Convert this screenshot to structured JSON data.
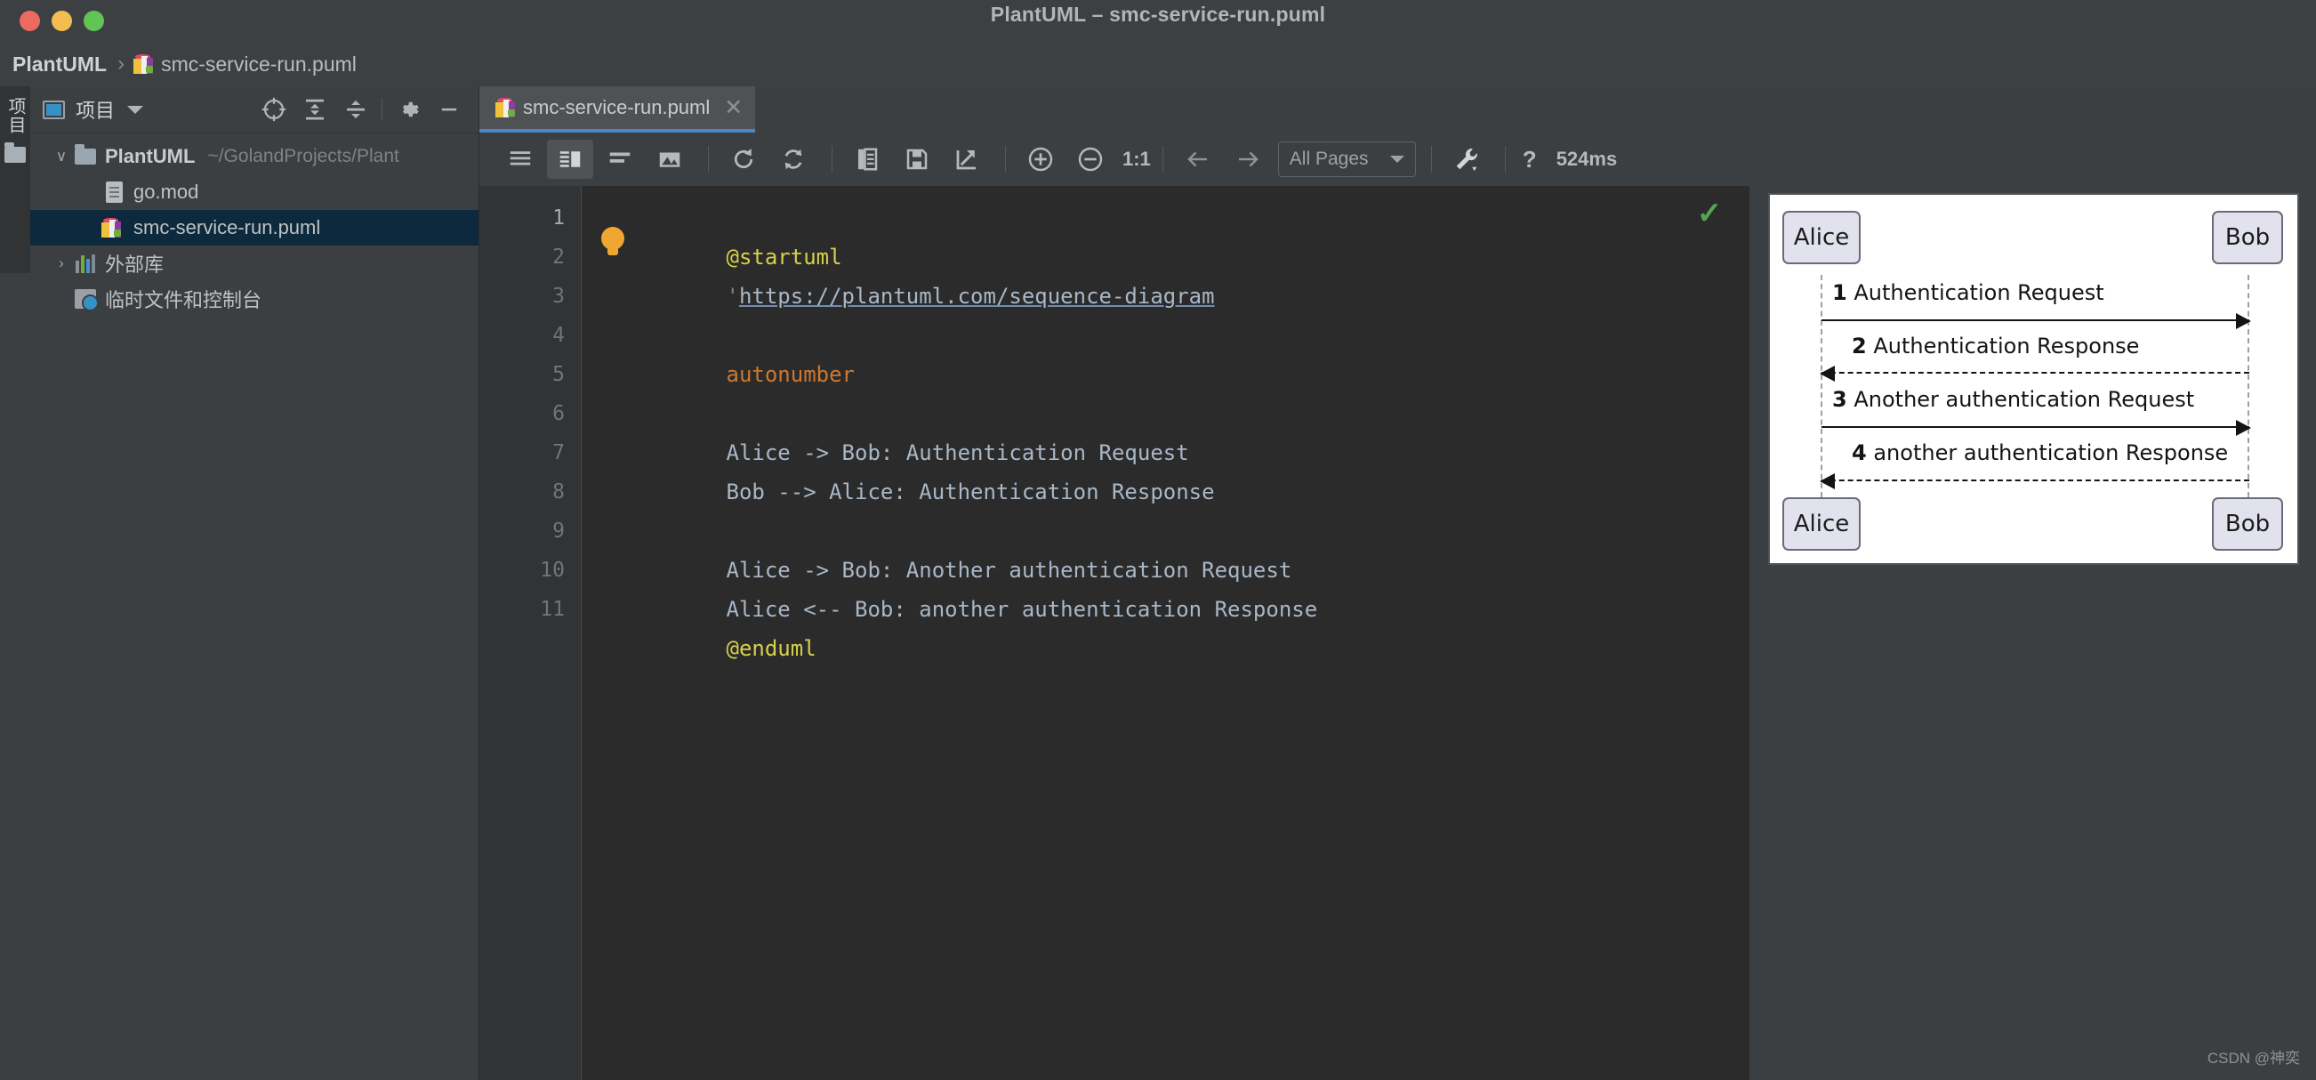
{
  "window": {
    "title": "PlantUML – smc-service-run.puml",
    "traffic_lights": [
      "close",
      "minimize",
      "zoom"
    ]
  },
  "breadcrumb": {
    "project": "PlantUML",
    "separator": "›",
    "file": "smc-service-run.puml"
  },
  "rail": {
    "project_label": "项目",
    "folder_icon": "folder-icon"
  },
  "project_panel": {
    "title": "项目",
    "tools": [
      {
        "name": "locate-icon",
        "label": "Select Opened File"
      },
      {
        "name": "expand-all-icon",
        "label": "Expand All"
      },
      {
        "name": "collapse-all-icon",
        "label": "Collapse All"
      },
      {
        "name": "settings-gear-icon",
        "label": "Options"
      },
      {
        "name": "hide-icon",
        "label": "Hide"
      }
    ],
    "tree": [
      {
        "twist": "∨",
        "icon": "folder-icon",
        "name": "PlantUML",
        "path": "~/GolandProjects/Plant",
        "bold": true,
        "selected": false,
        "indent": 0
      },
      {
        "twist": "",
        "icon": "go-mod-icon",
        "name": "go.mod",
        "path": "",
        "bold": false,
        "selected": false,
        "indent": 1
      },
      {
        "twist": "",
        "icon": "puml-icon",
        "name": "smc-service-run.puml",
        "path": "",
        "bold": false,
        "selected": true,
        "indent": 1
      },
      {
        "twist": "›",
        "icon": "library-icon",
        "name": "外部库",
        "path": "",
        "bold": false,
        "selected": false,
        "indent": 0
      },
      {
        "twist": "",
        "icon": "scratches-icon",
        "name": "临时文件和控制台",
        "path": "",
        "bold": false,
        "selected": false,
        "indent": 0
      }
    ]
  },
  "editor": {
    "tab": {
      "label": "smc-service-run.puml",
      "close": "✕",
      "icon": "puml-icon"
    },
    "inspection_status": "✓",
    "lightbulb": "intention-bulb-icon",
    "lines": [
      {
        "n": "1",
        "tokens": [
          {
            "t": "@startuml",
            "c": "tag"
          }
        ]
      },
      {
        "n": "2",
        "tokens": [
          {
            "t": "'",
            "c": "cmt"
          },
          {
            "t": "https://plantuml.com/sequence-diagram",
            "c": "url"
          }
        ]
      },
      {
        "n": "3",
        "tokens": []
      },
      {
        "n": "4",
        "tokens": [
          {
            "t": "autonumber",
            "c": "kw"
          }
        ]
      },
      {
        "n": "5",
        "tokens": []
      },
      {
        "n": "6",
        "tokens": [
          {
            "t": "Alice -> Bob: Authentication Request",
            "c": "txt"
          }
        ]
      },
      {
        "n": "7",
        "tokens": [
          {
            "t": "Bob --> Alice: Authentication Response",
            "c": "txt"
          }
        ]
      },
      {
        "n": "8",
        "tokens": []
      },
      {
        "n": "9",
        "tokens": [
          {
            "t": "Alice -> Bob: Another authentication Request",
            "c": "txt"
          }
        ]
      },
      {
        "n": "10",
        "tokens": [
          {
            "t": "Alice <-- Bob: another authentication Response",
            "c": "txt"
          }
        ]
      },
      {
        "n": "11",
        "tokens": [
          {
            "t": "@enduml",
            "c": "tag"
          }
        ]
      }
    ]
  },
  "preview_toolbar": {
    "buttons": [
      {
        "name": "layout-source-icon",
        "active": false
      },
      {
        "name": "layout-split-icon",
        "active": true
      },
      {
        "name": "layout-preview-icon",
        "active": false
      },
      {
        "name": "image-icon",
        "active": false
      },
      {
        "name": "refresh-icon",
        "active": false
      },
      {
        "name": "auto-refresh-icon",
        "active": false
      },
      {
        "name": "copy-icon",
        "active": false
      },
      {
        "name": "save-icon",
        "active": false
      },
      {
        "name": "open-external-icon",
        "active": false
      },
      {
        "name": "zoom-in-icon",
        "active": false
      },
      {
        "name": "zoom-out-icon",
        "active": false
      }
    ],
    "zoom_reset_label": "1:1",
    "prev_page_icon": "arrow-left-icon",
    "next_page_icon": "arrow-right-icon",
    "pages_select": "All Pages",
    "settings_icon": "wrench-icon",
    "help_icon": "?",
    "render_time": "524ms"
  },
  "diagram": {
    "type": "sequence",
    "participants": [
      "Alice",
      "Bob"
    ],
    "messages": [
      {
        "num": "1",
        "text": "Authentication Request",
        "from": "Alice",
        "to": "Bob",
        "style": "solid"
      },
      {
        "num": "2",
        "text": "Authentication Response",
        "from": "Bob",
        "to": "Alice",
        "style": "dashed"
      },
      {
        "num": "3",
        "text": "Another authentication Request",
        "from": "Alice",
        "to": "Bob",
        "style": "solid"
      },
      {
        "num": "4",
        "text": "another authentication Response",
        "from": "Bob",
        "to": "Alice",
        "style": "dashed"
      }
    ]
  },
  "watermark": "CSDN @神奕",
  "colors": {
    "chrome": "#3c3f41",
    "titlebar": "#3c4043",
    "editor_bg": "#2b2b2b",
    "gutter_bg": "#313335",
    "selection": "#0d293e",
    "tab_accent": "#4a88c7",
    "ok_green": "#53a653",
    "tag_yellow": "#d6d04a",
    "keyword_orange": "#cc7832",
    "text_blue_grey": "#a9b7c6",
    "actor_fill": "#e2e2ee"
  }
}
